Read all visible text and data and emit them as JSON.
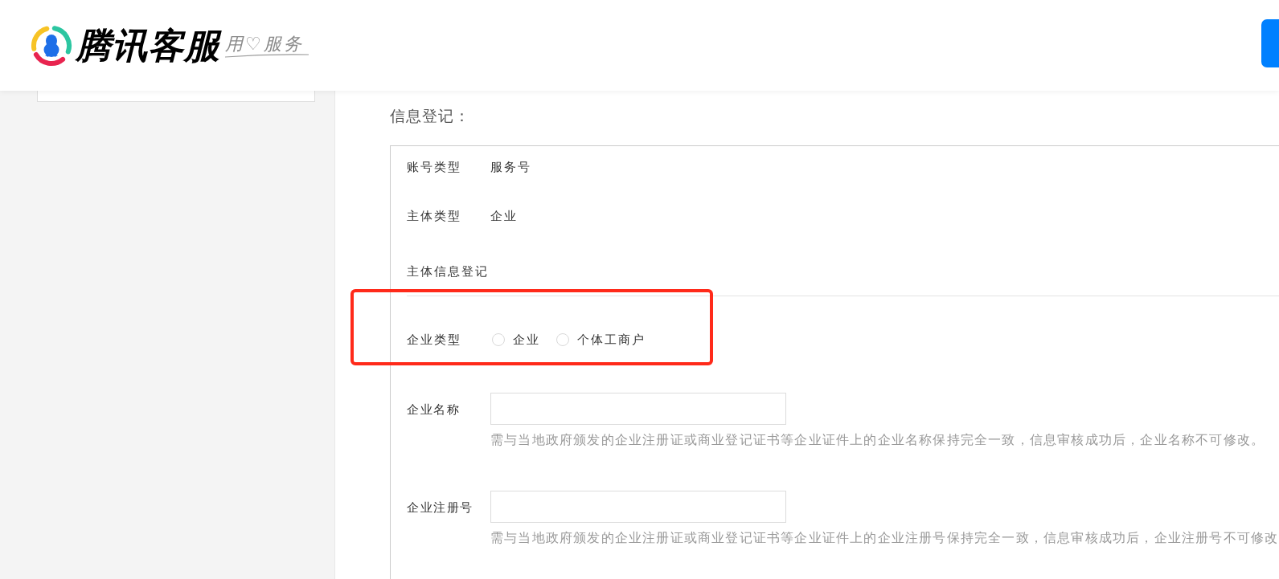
{
  "header": {
    "logo_text": "腾讯客服",
    "slogan": "用♡服务"
  },
  "section_title": "信息登记：",
  "info_rows": [
    {
      "label": "账号类型",
      "value": "服务号"
    },
    {
      "label": "主体类型",
      "value": "企业"
    }
  ],
  "subsection_title": "主体信息登记",
  "company_type": {
    "label": "企业类型",
    "options": [
      {
        "label": "企业",
        "selected": false
      },
      {
        "label": "个体工商户",
        "selected": false
      }
    ]
  },
  "fields": [
    {
      "label": "企业名称",
      "hint": "需与当地政府颁发的企业注册证或商业登记证书等企业证件上的企业名称保持完全一致，信息审核成功后，企业名称不可修改。"
    },
    {
      "label": "企业注册号",
      "hint": "需与当地政府颁发的企业注册证或商业登记证书等企业证件上的企业注册号保持完全一致，信息审核成功后，企业注册号不可修改"
    }
  ]
}
